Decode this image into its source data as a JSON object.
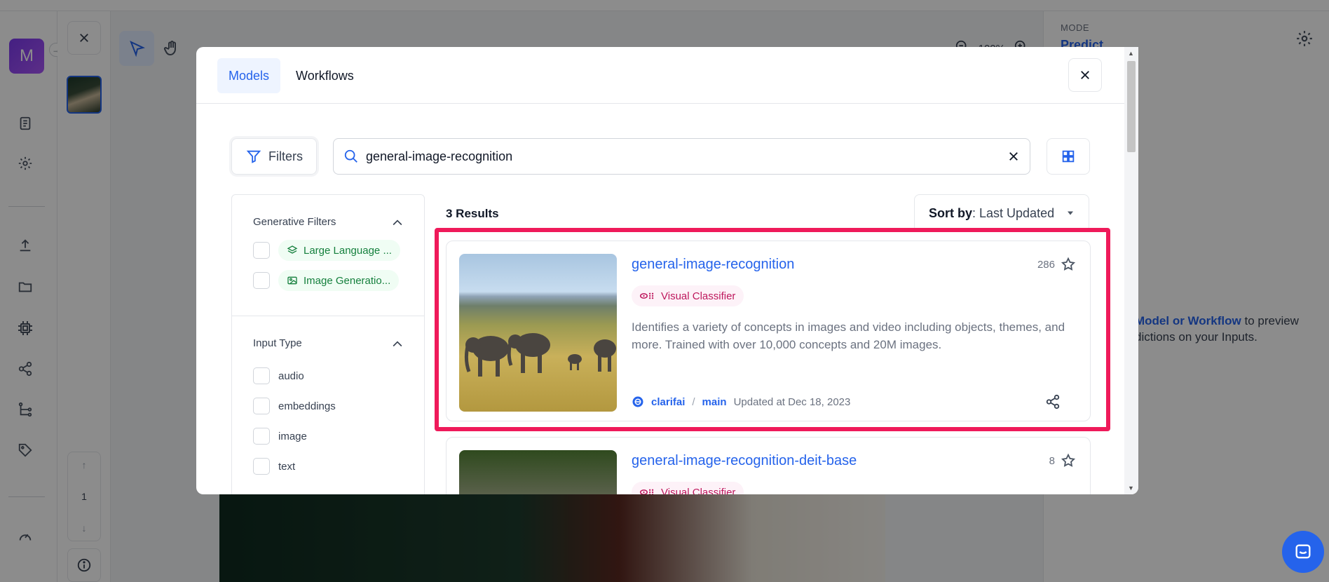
{
  "app": {
    "avatar_letter": "M",
    "pager_number": "1",
    "zoom_level": "100%",
    "mode_label": "MODE",
    "mode_value": "Predict",
    "hint_link": "Model or Workflow",
    "hint_text_1": " to preview",
    "hint_text_2": "dictions on your Inputs."
  },
  "modal": {
    "tabs": [
      {
        "label": "Models",
        "active": true
      },
      {
        "label": "Workflows",
        "active": false
      }
    ],
    "filters_label": "Filters",
    "search_value": "general-image-recognition",
    "results_count": "3 Results",
    "sort_label": "Sort by",
    "sort_value": ": Last Updated",
    "sidebar": {
      "generative_title": "Generative Filters",
      "generative_items": [
        "Large Language ...",
        "Image Generatio..."
      ],
      "input_title": "Input Type",
      "input_items": [
        "audio",
        "embeddings",
        "image",
        "text"
      ]
    },
    "cards": [
      {
        "title": "general-image-recognition",
        "stars": "286",
        "type": "Visual Classifier",
        "description": "Identifies a variety of concepts in images and video including objects, themes, and more. Trained with over 10,000 concepts and 20M images.",
        "owner": "clarifai",
        "branch": "main",
        "updated": "Updated at Dec 18, 2023"
      },
      {
        "title": "general-image-recognition-deit-base",
        "stars": "8",
        "type": "Visual Classifier"
      }
    ]
  },
  "colors": {
    "accent": "#2563eb",
    "highlight": "#ef1a5a",
    "avatar": "#7c3aed"
  }
}
